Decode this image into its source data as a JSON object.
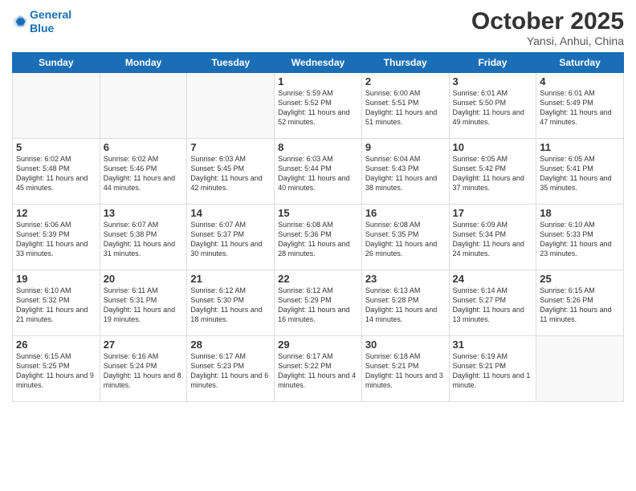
{
  "header": {
    "logo_line1": "General",
    "logo_line2": "Blue",
    "month": "October 2025",
    "location": "Yansi, Anhui, China"
  },
  "weekdays": [
    "Sunday",
    "Monday",
    "Tuesday",
    "Wednesday",
    "Thursday",
    "Friday",
    "Saturday"
  ],
  "weeks": [
    [
      {
        "day": "",
        "text": ""
      },
      {
        "day": "",
        "text": ""
      },
      {
        "day": "",
        "text": ""
      },
      {
        "day": "1",
        "text": "Sunrise: 5:59 AM\nSunset: 5:52 PM\nDaylight: 11 hours and 52 minutes."
      },
      {
        "day": "2",
        "text": "Sunrise: 6:00 AM\nSunset: 5:51 PM\nDaylight: 11 hours and 51 minutes."
      },
      {
        "day": "3",
        "text": "Sunrise: 6:01 AM\nSunset: 5:50 PM\nDaylight: 11 hours and 49 minutes."
      },
      {
        "day": "4",
        "text": "Sunrise: 6:01 AM\nSunset: 5:49 PM\nDaylight: 11 hours and 47 minutes."
      }
    ],
    [
      {
        "day": "5",
        "text": "Sunrise: 6:02 AM\nSunset: 5:48 PM\nDaylight: 11 hours and 45 minutes."
      },
      {
        "day": "6",
        "text": "Sunrise: 6:02 AM\nSunset: 5:46 PM\nDaylight: 11 hours and 44 minutes."
      },
      {
        "day": "7",
        "text": "Sunrise: 6:03 AM\nSunset: 5:45 PM\nDaylight: 11 hours and 42 minutes."
      },
      {
        "day": "8",
        "text": "Sunrise: 6:03 AM\nSunset: 5:44 PM\nDaylight: 11 hours and 40 minutes."
      },
      {
        "day": "9",
        "text": "Sunrise: 6:04 AM\nSunset: 5:43 PM\nDaylight: 11 hours and 38 minutes."
      },
      {
        "day": "10",
        "text": "Sunrise: 6:05 AM\nSunset: 5:42 PM\nDaylight: 11 hours and 37 minutes."
      },
      {
        "day": "11",
        "text": "Sunrise: 6:05 AM\nSunset: 5:41 PM\nDaylight: 11 hours and 35 minutes."
      }
    ],
    [
      {
        "day": "12",
        "text": "Sunrise: 6:06 AM\nSunset: 5:39 PM\nDaylight: 11 hours and 33 minutes."
      },
      {
        "day": "13",
        "text": "Sunrise: 6:07 AM\nSunset: 5:38 PM\nDaylight: 11 hours and 31 minutes."
      },
      {
        "day": "14",
        "text": "Sunrise: 6:07 AM\nSunset: 5:37 PM\nDaylight: 11 hours and 30 minutes."
      },
      {
        "day": "15",
        "text": "Sunrise: 6:08 AM\nSunset: 5:36 PM\nDaylight: 11 hours and 28 minutes."
      },
      {
        "day": "16",
        "text": "Sunrise: 6:08 AM\nSunset: 5:35 PM\nDaylight: 11 hours and 26 minutes."
      },
      {
        "day": "17",
        "text": "Sunrise: 6:09 AM\nSunset: 5:34 PM\nDaylight: 11 hours and 24 minutes."
      },
      {
        "day": "18",
        "text": "Sunrise: 6:10 AM\nSunset: 5:33 PM\nDaylight: 11 hours and 23 minutes."
      }
    ],
    [
      {
        "day": "19",
        "text": "Sunrise: 6:10 AM\nSunset: 5:32 PM\nDaylight: 11 hours and 21 minutes."
      },
      {
        "day": "20",
        "text": "Sunrise: 6:11 AM\nSunset: 5:31 PM\nDaylight: 11 hours and 19 minutes."
      },
      {
        "day": "21",
        "text": "Sunrise: 6:12 AM\nSunset: 5:30 PM\nDaylight: 11 hours and 18 minutes."
      },
      {
        "day": "22",
        "text": "Sunrise: 6:12 AM\nSunset: 5:29 PM\nDaylight: 11 hours and 16 minutes."
      },
      {
        "day": "23",
        "text": "Sunrise: 6:13 AM\nSunset: 5:28 PM\nDaylight: 11 hours and 14 minutes."
      },
      {
        "day": "24",
        "text": "Sunrise: 6:14 AM\nSunset: 5:27 PM\nDaylight: 11 hours and 13 minutes."
      },
      {
        "day": "25",
        "text": "Sunrise: 6:15 AM\nSunset: 5:26 PM\nDaylight: 11 hours and 11 minutes."
      }
    ],
    [
      {
        "day": "26",
        "text": "Sunrise: 6:15 AM\nSunset: 5:25 PM\nDaylight: 11 hours and 9 minutes."
      },
      {
        "day": "27",
        "text": "Sunrise: 6:16 AM\nSunset: 5:24 PM\nDaylight: 11 hours and 8 minutes."
      },
      {
        "day": "28",
        "text": "Sunrise: 6:17 AM\nSunset: 5:23 PM\nDaylight: 11 hours and 6 minutes."
      },
      {
        "day": "29",
        "text": "Sunrise: 6:17 AM\nSunset: 5:22 PM\nDaylight: 11 hours and 4 minutes."
      },
      {
        "day": "30",
        "text": "Sunrise: 6:18 AM\nSunset: 5:21 PM\nDaylight: 11 hours and 3 minutes."
      },
      {
        "day": "31",
        "text": "Sunrise: 6:19 AM\nSunset: 5:21 PM\nDaylight: 11 hours and 1 minute."
      },
      {
        "day": "",
        "text": ""
      }
    ]
  ]
}
